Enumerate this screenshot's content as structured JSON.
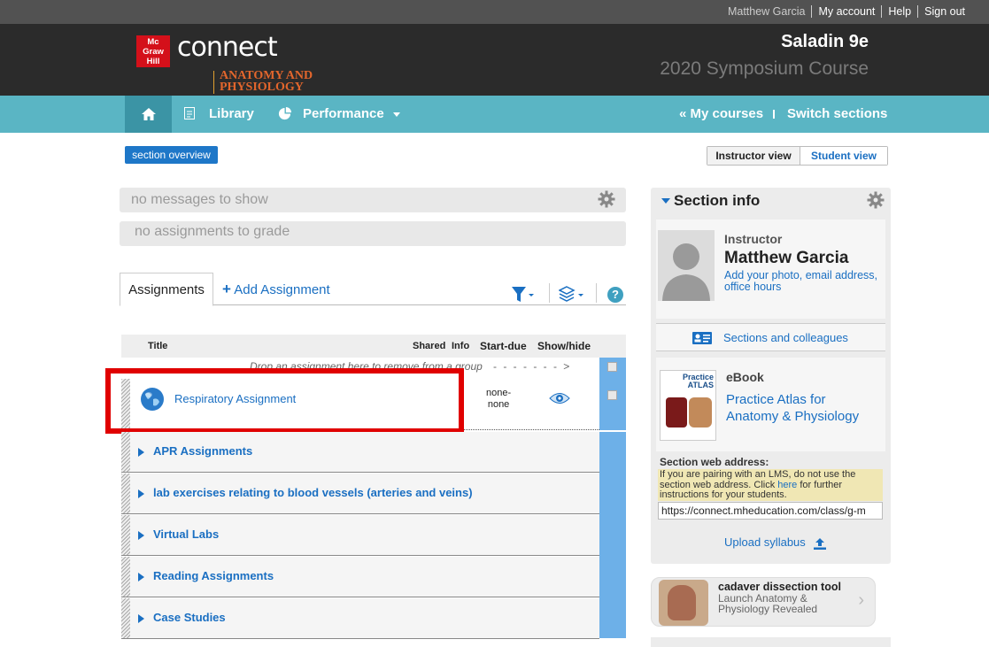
{
  "utility": {
    "user_name": "Matthew Garcia",
    "my_account": "My account",
    "help": "Help",
    "sign_out": "Sign out"
  },
  "header": {
    "logo_text": "Mc Graw Hill",
    "product": "connect",
    "subject": "ANATOMY AND PHYSIOLOGY",
    "course_title": "Saladin 9e",
    "course_subtitle": "2020 Symposium Course"
  },
  "nav": {
    "library": "Library",
    "performance": "Performance",
    "my_courses": "« My courses",
    "switch_sections": "Switch sections"
  },
  "section_overview": "section overview",
  "view_toggle": {
    "instructor": "Instructor view",
    "student": "Student view"
  },
  "messages": {
    "none": "no messages to show",
    "grade": "no assignments to grade"
  },
  "tabs": {
    "assignments": "Assignments",
    "add_assignment": "Add Assignment"
  },
  "table": {
    "headers": {
      "title": "Title",
      "shared": "Shared",
      "info": "Info",
      "start_due": "Start-due",
      "show_hide": "Show/hide"
    },
    "drop_hint": "Drop an assignment here to remove from a group",
    "assignment": {
      "name": "Respiratory Assignment",
      "start_due": "none-\nnone"
    },
    "groups": [
      "APR Assignments",
      "lab exercises relating to blood vessels (arteries and veins)",
      "Virtual Labs",
      "Reading Assignments",
      "Case Studies"
    ]
  },
  "section_info": {
    "title": "Section info",
    "instructor_label": "Instructor",
    "instructor_name": "Matthew Garcia",
    "instructor_link": "Add your photo, email address, office hours",
    "sections_colleagues": "Sections and colleagues",
    "ebook_label": "eBook",
    "ebook_title": "Practice Atlas for Anatomy & Physiology",
    "ebook_thumb_text": "Practice ATLAS",
    "web_address_label": "Section web address:",
    "web_address_note_pre": "If you are pairing with an LMS, do not use the section web address. Click ",
    "web_address_note_link": "here",
    "web_address_note_post": " for further instructions for your students.",
    "web_address": "https://connect.mheducation.com/class/g-m",
    "upload_syllabus": "Upload syllabus"
  },
  "cadaver": {
    "title": "cadaver dissection tool",
    "subtitle": "Launch Anatomy & Physiology Revealed"
  },
  "colors": {
    "accent_blue": "#1a6fc2",
    "nav_teal": "#5ab5c4",
    "highlight_red": "#e00000"
  }
}
